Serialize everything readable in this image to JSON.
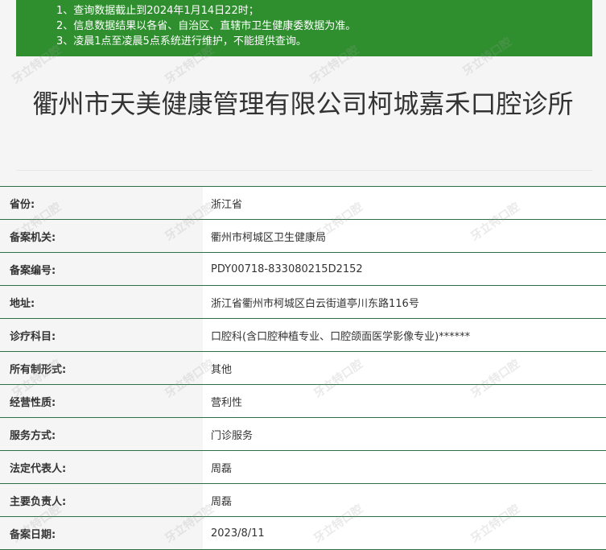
{
  "notice": {
    "lines": [
      "1、查询数据截止到2024年1月14日22时；",
      "2、信息数据结果以各省、自治区、直辖市卫生健康委数据为准。",
      "3、凌晨1点至凌晨5点系统进行维护，不能提供查询。"
    ],
    "bg_color": "#2f8f2f"
  },
  "title": "衢州市天美健康管理有限公司柯城嘉禾口腔诊所",
  "rows": [
    {
      "label": "省份:",
      "value": "浙江省"
    },
    {
      "label": "备案机关:",
      "value": "衢州市柯城区卫生健康局"
    },
    {
      "label": "备案编号:",
      "value": "PDY00718-833080215D2152"
    },
    {
      "label": "地址:",
      "value": "浙江省衢州市柯城区白云街道亭川东路116号"
    },
    {
      "label": "诊疗科目:",
      "value": "口腔科(含口腔种植专业、口腔颌面医学影像专业)******"
    },
    {
      "label": "所有制形式:",
      "value": "其他"
    },
    {
      "label": "经营性质:",
      "value": "营利性"
    },
    {
      "label": "服务方式:",
      "value": "门诊服务"
    },
    {
      "label": "法定代表人:",
      "value": "周磊"
    },
    {
      "label": "主要负责人:",
      "value": "周磊"
    },
    {
      "label": "备案日期:",
      "value": "2023/8/11"
    }
  ],
  "watermark": "牙立特口腔"
}
